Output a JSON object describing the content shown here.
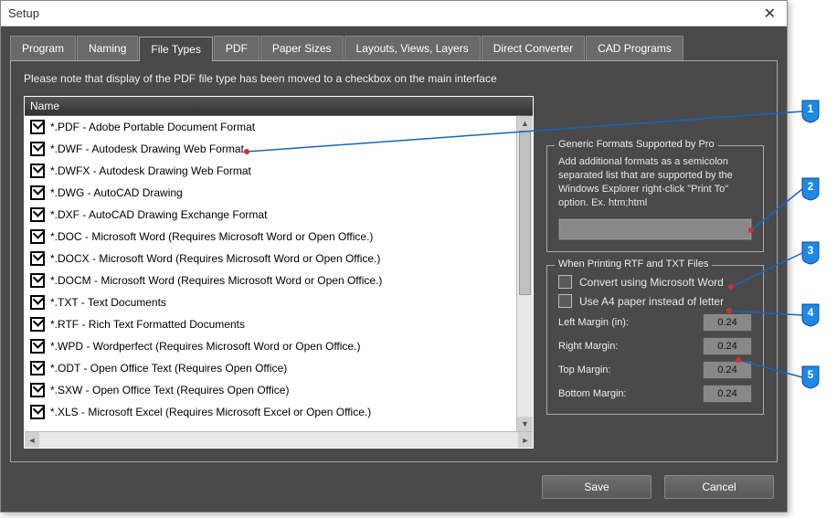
{
  "window": {
    "title": "Setup"
  },
  "tabs": {
    "items": [
      {
        "label": "Program"
      },
      {
        "label": "Naming"
      },
      {
        "label": "File Types"
      },
      {
        "label": "PDF"
      },
      {
        "label": "Paper Sizes"
      },
      {
        "label": "Layouts, Views, Layers"
      },
      {
        "label": "Direct Converter"
      },
      {
        "label": "CAD Programs"
      }
    ],
    "active_index": 2
  },
  "note": "Please note that display of the PDF file type has been moved to a checkbox on the main interface",
  "filetypes": {
    "header": "Name",
    "items": [
      {
        "label": "*.PDF - Adobe Portable Document Format"
      },
      {
        "label": "*.DWF - Autodesk Drawing Web Format"
      },
      {
        "label": "*.DWFX - Autodesk Drawing Web Format"
      },
      {
        "label": "*.DWG - AutoCAD Drawing"
      },
      {
        "label": "*.DXF - AutoCAD Drawing Exchange Format"
      },
      {
        "label": "*.DOC - Microsoft Word (Requires Microsoft Word or Open Office.)"
      },
      {
        "label": "*.DOCX - Microsoft Word (Requires Microsoft Word or Open Office.)"
      },
      {
        "label": "*.DOCM - Microsoft Word (Requires Microsoft Word or Open Office.)"
      },
      {
        "label": "*.TXT - Text Documents"
      },
      {
        "label": "*.RTF - Rich Text Formatted Documents"
      },
      {
        "label": "*.WPD - Wordperfect (Requires Microsoft Word or Open Office.)"
      },
      {
        "label": "*.ODT - Open Office Text (Requires Open Office)"
      },
      {
        "label": "*.SXW - Open Office Text (Requires Open Office)"
      },
      {
        "label": "*.XLS - Microsoft Excel (Requires Microsoft Excel or Open Office.)"
      }
    ]
  },
  "generic_formats": {
    "legend": "Generic Formats Supported by Pro",
    "desc": "Add additional formats as a semicolon separated list that are supported by the Windows Explorer right-click \"Print To\" option.  Ex. htm;html",
    "value": ""
  },
  "rtf_txt": {
    "legend": "When Printing RTF and TXT Files",
    "convert_label": "Convert using Microsoft Word",
    "a4_label": "Use A4 paper instead of letter",
    "left_label": "Left Margin (in):",
    "right_label": "Right Margin:",
    "top_label": "Top Margin:",
    "bottom_label": "Bottom Margin:",
    "left": "0.24",
    "right": "0.24",
    "top": "0.24",
    "bottom": "0.24"
  },
  "buttons": {
    "save": "Save",
    "cancel": "Cancel"
  },
  "callouts": {
    "c1": "1",
    "c2": "2",
    "c3": "3",
    "c4": "4",
    "c5": "5"
  }
}
